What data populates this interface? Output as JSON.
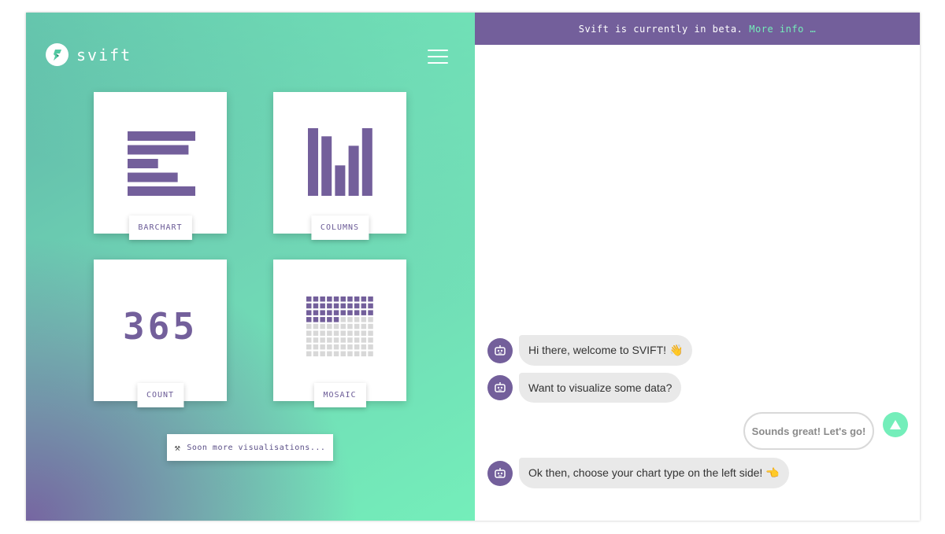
{
  "logo": {
    "text": "svift"
  },
  "cards": {
    "barchart": {
      "label": "BARCHART",
      "bars": [
        1.0,
        0.9,
        0.45,
        0.74,
        1.0
      ]
    },
    "columns": {
      "label": "COLUMNS",
      "bars": [
        1.0,
        0.88,
        0.45,
        0.74,
        1.0
      ]
    },
    "count": {
      "label": "COUNT",
      "number": "365"
    },
    "mosaic": {
      "label": "MOSAIC",
      "filled": 35,
      "total": 90
    }
  },
  "soon": {
    "icon": "⚒",
    "text": "Soon more visualisations..."
  },
  "beta": {
    "text": "Svift is currently in beta.",
    "link": "More info …"
  },
  "chat": [
    {
      "from": "bot",
      "text": "Hi there, welcome to SVIFT! 👋"
    },
    {
      "from": "bot",
      "text": "Want to visualize some data?"
    },
    {
      "from": "user",
      "text": "Sounds great! Let's go!"
    },
    {
      "from": "bot",
      "text": "Ok then, choose your chart type on the left side! 👈"
    }
  ],
  "colors": {
    "purple": "#735f9b",
    "mint": "#74eeba",
    "bubble": "#e9e9e9"
  }
}
